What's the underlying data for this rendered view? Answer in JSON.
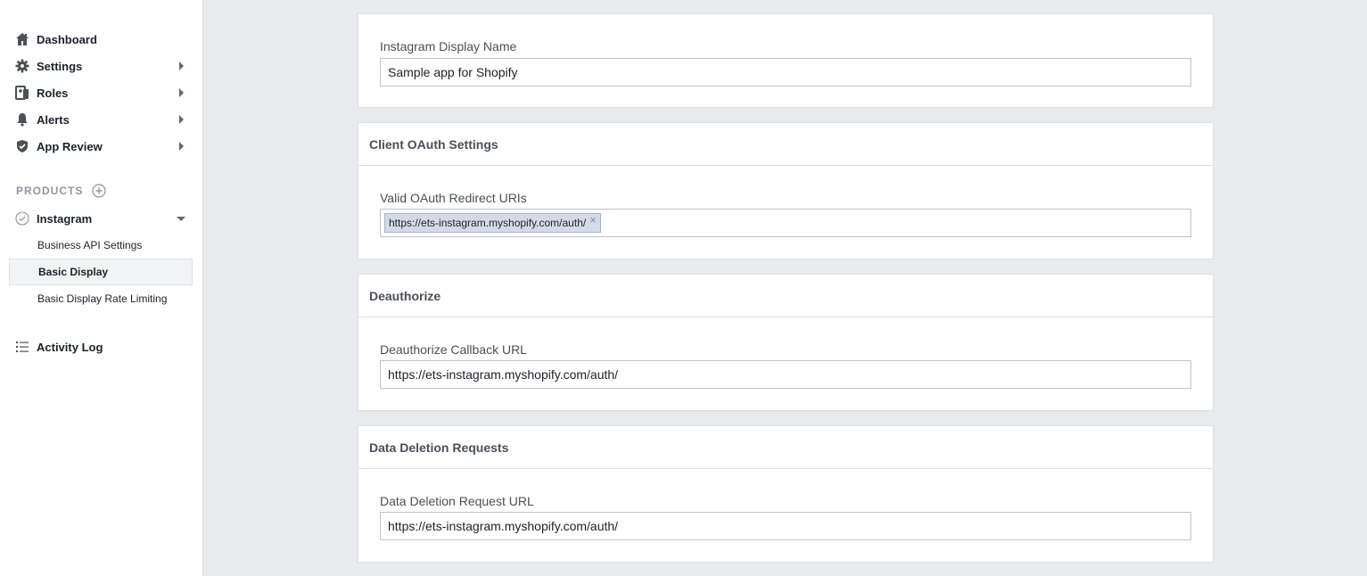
{
  "sidebar": {
    "items": [
      {
        "label": "Dashboard",
        "icon": "home-icon"
      },
      {
        "label": "Settings",
        "icon": "gear-icon"
      },
      {
        "label": "Roles",
        "icon": "roles-icon"
      },
      {
        "label": "Alerts",
        "icon": "bell-icon"
      },
      {
        "label": "App Review",
        "icon": "shield-check-icon"
      }
    ],
    "products_heading": "PRODUCTS",
    "product": {
      "label": "Instagram",
      "icon": "check-circle-icon"
    },
    "sub_items": [
      {
        "label": "Business API Settings"
      },
      {
        "label": "Basic Display"
      },
      {
        "label": "Basic Display Rate Limiting"
      }
    ],
    "activity_log": {
      "label": "Activity Log",
      "icon": "list-icon"
    }
  },
  "main": {
    "display_name": {
      "label": "Instagram Display Name",
      "value": "Sample app for Shopify"
    },
    "oauth": {
      "header": "Client OAuth Settings",
      "label": "Valid OAuth Redirect URIs",
      "token": "https://ets-instagram.myshopify.com/auth/",
      "token_remove": "×"
    },
    "deauthorize": {
      "header": "Deauthorize",
      "label": "Deauthorize Callback URL",
      "value": "https://ets-instagram.myshopify.com/auth/"
    },
    "data_deletion": {
      "header": "Data Deletion Requests",
      "label": "Data Deletion Request URL",
      "value": "https://ets-instagram.myshopify.com/auth/"
    }
  },
  "colors": {
    "background": "#e9eaed",
    "sidebar": "#ffffff",
    "token_bg": "#d5dbe6",
    "token_border": "#9cb4d8"
  }
}
